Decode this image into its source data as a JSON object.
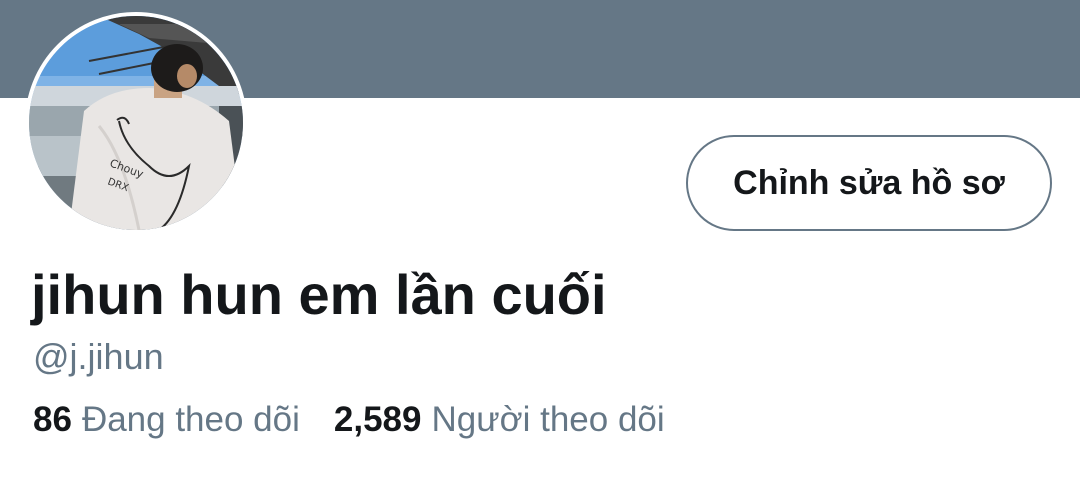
{
  "profile": {
    "display_name": "jihun hun em lần cuối",
    "handle": "@j.jihun",
    "edit_button_label": "Chỉnh sửa hồ sơ",
    "stats": {
      "following_count": "86",
      "following_label": "Đang theo dõi",
      "followers_count": "2,589",
      "followers_label": "Người theo dõi"
    }
  },
  "colors": {
    "banner": "#657786",
    "primary_text": "#14171a",
    "secondary_text": "#657786",
    "background": "#ffffff"
  }
}
